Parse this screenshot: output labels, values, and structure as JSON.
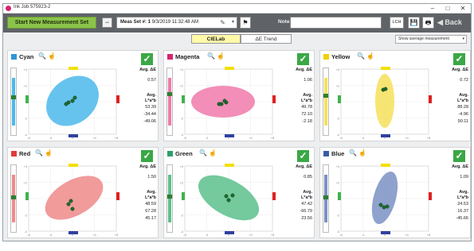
{
  "window": {
    "title": "Ink Job 575923-2",
    "minimize": "–",
    "maximize": "□",
    "close": "✕"
  },
  "toolbar": {
    "start_new": "Start New Measurement Set",
    "minus": "−",
    "meas_set_label": "Meas Set #: 1",
    "meas_set_date": "9/3/2019 11:32:48 AM",
    "pencil": "✎",
    "dropdown": "▾",
    "flag": "⚑",
    "notes_label": "Notes:",
    "notes_value": "",
    "lch": "LCH",
    "save": "💾",
    "print": "🖶",
    "back": "◀ Back"
  },
  "tabs": [
    {
      "label": "CIELab",
      "active": true
    },
    {
      "label": "ΔE Trend",
      "active": false
    }
  ],
  "view_select": "Show average measurement",
  "common": {
    "avg_de_label": "Avg. ΔE",
    "avg_lab_label": "Avg. L*a*b",
    "search_icon": "🔍",
    "hand_icon": "☝",
    "check_icon": "✓",
    "l_axis_label": "ΔL*",
    "l_ticks": [
      "+4",
      "+2",
      "0",
      "-2",
      "-4"
    ],
    "x_ticks": [
      "-8",
      "-4",
      "0",
      "+4",
      "+8"
    ],
    "y_ticks": [
      "+4",
      "+2",
      "0",
      "-2",
      "-4"
    ]
  },
  "panels": [
    {
      "name": "Cyan",
      "swatch": "#2e97d4",
      "ellipse": "#4bb9ea",
      "avg_de": "0.57",
      "L": "53.39",
      "a": "-34.44",
      "b": "-49.06",
      "lbar_color": "#4bb9ea"
    },
    {
      "name": "Magenta",
      "swatch": "#d6246e",
      "ellipse": "#f07aaa",
      "avg_de": "1.06",
      "L": "49.78",
      "a": "72.10",
      "b": "-2.18",
      "lbar_color": "#f07aaa"
    },
    {
      "name": "Yellow",
      "swatch": "#f2d000",
      "ellipse": "#f6e05a",
      "avg_de": "0.72",
      "L": "88.28",
      "a": "-4.96",
      "b": "90.11",
      "lbar_color": "#f6e05a"
    },
    {
      "name": "Red",
      "swatch": "#e23a3a",
      "ellipse": "#ef8a8a",
      "avg_de": "1.50",
      "L": "48.59",
      "a": "67.28",
      "b": "45.17",
      "lbar_color": "#ef8a8a"
    },
    {
      "name": "Green",
      "swatch": "#2ea06a",
      "ellipse": "#5cbf8c",
      "avg_de": "0.85",
      "L": "47.42",
      "a": "-66.79",
      "b": "23.56",
      "lbar_color": "#5cbf8c"
    },
    {
      "name": "Blue",
      "swatch": "#3a5ca8",
      "ellipse": "#7b90c4",
      "avg_de": "1.09",
      "L": "24.53",
      "a": "16.37",
      "b": "-45.66",
      "lbar_color": "#7b90c4"
    }
  ],
  "markers": {
    "yellow": "#f2e000",
    "red": "#e02020",
    "green": "#3bb54a",
    "blue": "#3040a0"
  }
}
